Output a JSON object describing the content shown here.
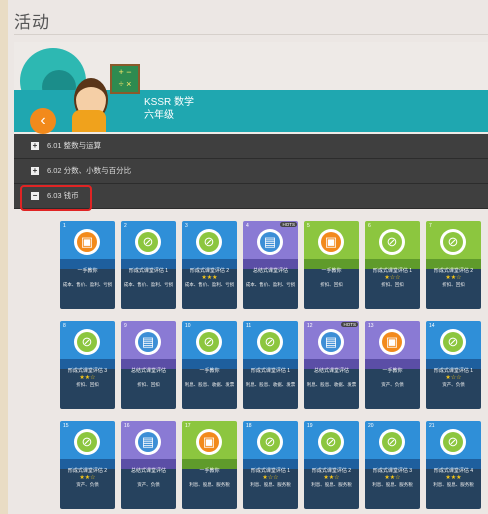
{
  "page": {
    "title": "活动"
  },
  "course": {
    "name": "KSSR 数学",
    "grade": "六年级"
  },
  "colors": {
    "teal": "#1fa7b0",
    "orange": "#f28a1c",
    "green": "#8cc63f",
    "blue": "#2f8fd8",
    "purple": "#8a7ad4",
    "highlight": "#e02424"
  },
  "sections": [
    {
      "label": "6.01 整数与运算",
      "toggle": "+"
    },
    {
      "label": "6.02 分数、小数与百分比",
      "toggle": "+"
    },
    {
      "label": "6.03 钱币",
      "toggle": "−"
    }
  ],
  "cards": [
    {
      "num": "1",
      "theme": "blue",
      "icon": "quiz-icon",
      "label": "一手教你",
      "stars": "",
      "desc": "成本、售价、盈利、亏损"
    },
    {
      "num": "2",
      "theme": "blue",
      "icon": "formative-icon",
      "label": "形成式课堂评估 1",
      "stars": "",
      "desc": "成本、售价、盈利、亏损"
    },
    {
      "num": "3",
      "theme": "blue",
      "icon": "formative-icon",
      "label": "形成式课堂评估 2",
      "stars": "★★★",
      "desc": "成本、售价、盈利、亏损"
    },
    {
      "num": "4",
      "theme": "purple",
      "icon": "document-icon",
      "label": "总结式课堂评估",
      "stars": "",
      "desc": "成本、售价、盈利、亏损",
      "pill": "HOTS"
    },
    {
      "num": "5",
      "theme": "green",
      "icon": "quiz-icon",
      "label": "一手教你",
      "stars": "",
      "desc": "折扣、回扣"
    },
    {
      "num": "6",
      "theme": "green",
      "icon": "formative-icon",
      "label": "形成式课堂评估 1",
      "stars": "★☆☆",
      "desc": "折扣、回扣"
    },
    {
      "num": "7",
      "theme": "green",
      "icon": "formative-icon",
      "label": "形成式课堂评估 2",
      "stars": "★★☆",
      "desc": "折扣、回扣"
    },
    {
      "num": "8",
      "theme": "blue",
      "icon": "formative-icon",
      "label": "形成式课堂评估 3",
      "stars": "★★☆",
      "desc": "折扣、回扣"
    },
    {
      "num": "9",
      "theme": "purple",
      "icon": "document-icon",
      "label": "总结式课堂评估",
      "stars": "",
      "desc": "折扣、回扣"
    },
    {
      "num": "10",
      "theme": "blue",
      "icon": "formative-icon",
      "label": "一手教你",
      "stars": "",
      "desc": "利息、股息、收据、发票"
    },
    {
      "num": "11",
      "theme": "blue",
      "icon": "formative-icon",
      "label": "形成式课堂评估 1",
      "stars": "",
      "desc": "利息、股息、收据、发票"
    },
    {
      "num": "12",
      "theme": "purple",
      "icon": "document-icon",
      "label": "总结式课堂评估",
      "stars": "",
      "desc": "利息、股息、收据、发票",
      "pill": "HOTS"
    },
    {
      "num": "13",
      "theme": "purple",
      "icon": "quiz-icon",
      "label": "一手教你",
      "stars": "",
      "desc": "资产、负债"
    },
    {
      "num": "14",
      "theme": "blue",
      "icon": "formative-icon",
      "label": "形成式课堂评估 1",
      "stars": "★☆☆",
      "desc": "资产、负债"
    },
    {
      "num": "15",
      "theme": "blue",
      "icon": "formative-icon",
      "label": "形成式课堂评估 2",
      "stars": "★★☆",
      "desc": "资产、负债"
    },
    {
      "num": "16",
      "theme": "purple",
      "icon": "document-icon",
      "label": "总结式课堂评估",
      "stars": "",
      "desc": "资产、负债"
    },
    {
      "num": "17",
      "theme": "green",
      "icon": "quiz-icon",
      "label": "一手教你",
      "stars": "",
      "desc": "利息、股息、服务税"
    },
    {
      "num": "18",
      "theme": "blue",
      "icon": "formative-icon",
      "label": "形成式课堂评估 1",
      "stars": "★☆☆",
      "desc": "利息、股息、服务税"
    },
    {
      "num": "19",
      "theme": "blue",
      "icon": "formative-icon",
      "label": "形成式课堂评估 2",
      "stars": "★★☆",
      "desc": "利息、股息、服务税"
    },
    {
      "num": "20",
      "theme": "blue",
      "icon": "formative-icon",
      "label": "形成式课堂评估 3",
      "stars": "★★☆",
      "desc": "利息、股息、服务税"
    },
    {
      "num": "21",
      "theme": "blue",
      "icon": "formative-icon",
      "label": "形成式课堂评估 4",
      "stars": "★★★",
      "desc": "利息、股息、服务税"
    }
  ]
}
